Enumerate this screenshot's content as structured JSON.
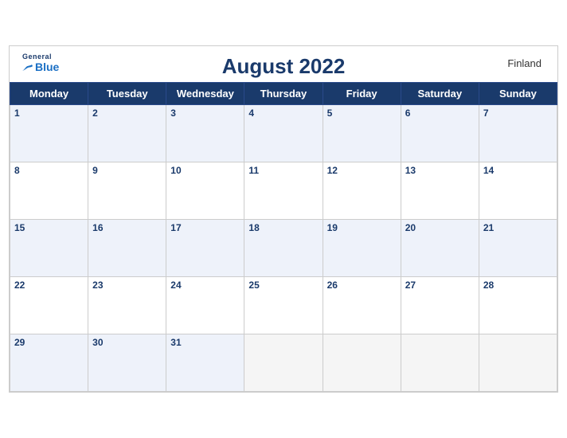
{
  "header": {
    "title": "August 2022",
    "country": "Finland",
    "brand_general": "General",
    "brand_blue": "Blue"
  },
  "weekdays": [
    "Monday",
    "Tuesday",
    "Wednesday",
    "Thursday",
    "Friday",
    "Saturday",
    "Sunday"
  ],
  "weeks": [
    [
      {
        "day": "1"
      },
      {
        "day": "2"
      },
      {
        "day": "3"
      },
      {
        "day": "4"
      },
      {
        "day": "5"
      },
      {
        "day": "6"
      },
      {
        "day": "7"
      }
    ],
    [
      {
        "day": "8"
      },
      {
        "day": "9"
      },
      {
        "day": "10"
      },
      {
        "day": "11"
      },
      {
        "day": "12"
      },
      {
        "day": "13"
      },
      {
        "day": "14"
      }
    ],
    [
      {
        "day": "15"
      },
      {
        "day": "16"
      },
      {
        "day": "17"
      },
      {
        "day": "18"
      },
      {
        "day": "19"
      },
      {
        "day": "20"
      },
      {
        "day": "21"
      }
    ],
    [
      {
        "day": "22"
      },
      {
        "day": "23"
      },
      {
        "day": "24"
      },
      {
        "day": "25"
      },
      {
        "day": "26"
      },
      {
        "day": "27"
      },
      {
        "day": "28"
      }
    ],
    [
      {
        "day": "29"
      },
      {
        "day": "30"
      },
      {
        "day": "31"
      },
      {
        "day": ""
      },
      {
        "day": ""
      },
      {
        "day": ""
      },
      {
        "day": ""
      }
    ]
  ],
  "colors": {
    "header_bg": "#1a3a6b",
    "accent": "#1a6fc4"
  }
}
